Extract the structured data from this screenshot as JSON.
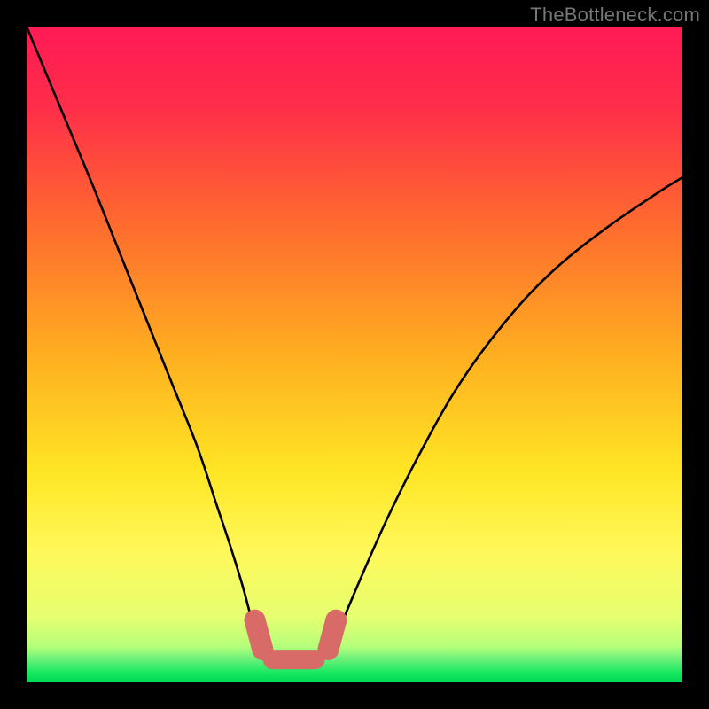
{
  "watermark": "TheBottleneck.com",
  "chart_data": {
    "type": "line",
    "title": "",
    "xlabel": "",
    "ylabel": "",
    "xlim": [
      0,
      100
    ],
    "ylim": [
      0,
      100
    ],
    "grid": false,
    "legend": false,
    "series": [
      {
        "name": "curve",
        "x": [
          0,
          5,
          10,
          14,
          18,
          22,
          26,
          29,
          31,
          33,
          34.5,
          36,
          37.5,
          41,
          44,
          46,
          48,
          51,
          55,
          60,
          66,
          73,
          80,
          88,
          96,
          100
        ],
        "y": [
          100,
          88,
          76,
          66,
          56,
          46,
          36,
          27,
          21,
          14.5,
          9,
          5,
          3,
          2.3,
          3,
          5,
          9,
          16,
          25,
          35,
          45.5,
          55,
          62.5,
          69,
          74.5,
          77
        ]
      }
    ],
    "markers": {
      "name": "highlight-band",
      "color": "#d86a68",
      "points": [
        {
          "x": 34.8,
          "y": 9.5,
          "kind": "segment"
        },
        {
          "x": 36.0,
          "y": 5.0,
          "kind": "segment"
        },
        {
          "x": 37.5,
          "y": 3.5,
          "kind": "flat"
        },
        {
          "x": 44.0,
          "y": 3.5,
          "kind": "flat"
        },
        {
          "x": 46.0,
          "y": 5.0,
          "kind": "segment"
        },
        {
          "x": 47.2,
          "y": 9.5,
          "kind": "segment"
        }
      ]
    },
    "background_gradient": {
      "stops": [
        {
          "pos": 0.0,
          "color": "#ff1a55"
        },
        {
          "pos": 0.12,
          "color": "#ff2d4a"
        },
        {
          "pos": 0.3,
          "color": "#ff6a2f"
        },
        {
          "pos": 0.5,
          "color": "#ffae20"
        },
        {
          "pos": 0.68,
          "color": "#ffe625"
        },
        {
          "pos": 0.8,
          "color": "#fff85a"
        },
        {
          "pos": 0.9,
          "color": "#e6ff70"
        },
        {
          "pos": 0.945,
          "color": "#b6ff7a"
        },
        {
          "pos": 0.965,
          "color": "#6af07a"
        },
        {
          "pos": 0.985,
          "color": "#18e860"
        },
        {
          "pos": 1.0,
          "color": "#00d858"
        }
      ]
    }
  }
}
